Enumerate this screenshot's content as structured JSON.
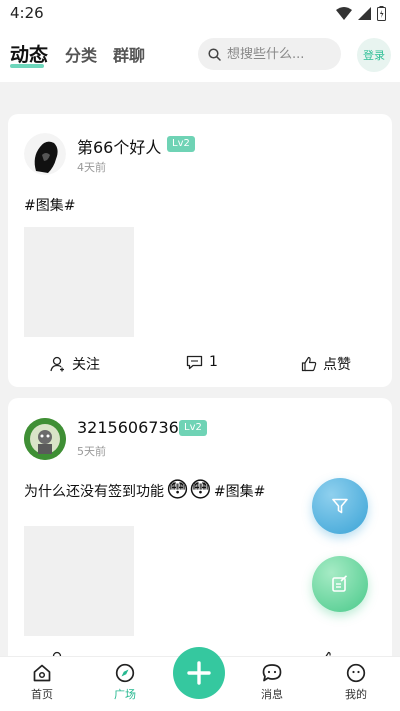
{
  "status_bar": {
    "time": "4:26"
  },
  "top_nav": {
    "tabs": [
      {
        "label": "动态",
        "active": true
      },
      {
        "label": "分类"
      },
      {
        "label": "群聊"
      }
    ],
    "search_placeholder": "想搜些什么...",
    "login_label": "登录"
  },
  "posts": [
    {
      "username": "第66个好人",
      "level": "Lv2",
      "time": "4天前",
      "text": "#图集#",
      "follow_label": "关注",
      "comment_count": "1",
      "like_label": "点赞"
    },
    {
      "username": "3215606736",
      "level": "Lv2",
      "time": "5天前",
      "text_before": "为什么还没有签到功能",
      "text_after": " #图集#",
      "emoji": "😳😳"
    }
  ],
  "bottom_nav": {
    "items": [
      {
        "label": "首页"
      },
      {
        "label": "广场",
        "active": true
      },
      {
        "label": "消息"
      },
      {
        "label": "我的"
      }
    ]
  },
  "colors": {
    "accent": "#35c89f",
    "level_badge": "#6fd3b5",
    "filter_fab": "#3aa3d6",
    "edit_fab": "#49c98a"
  }
}
